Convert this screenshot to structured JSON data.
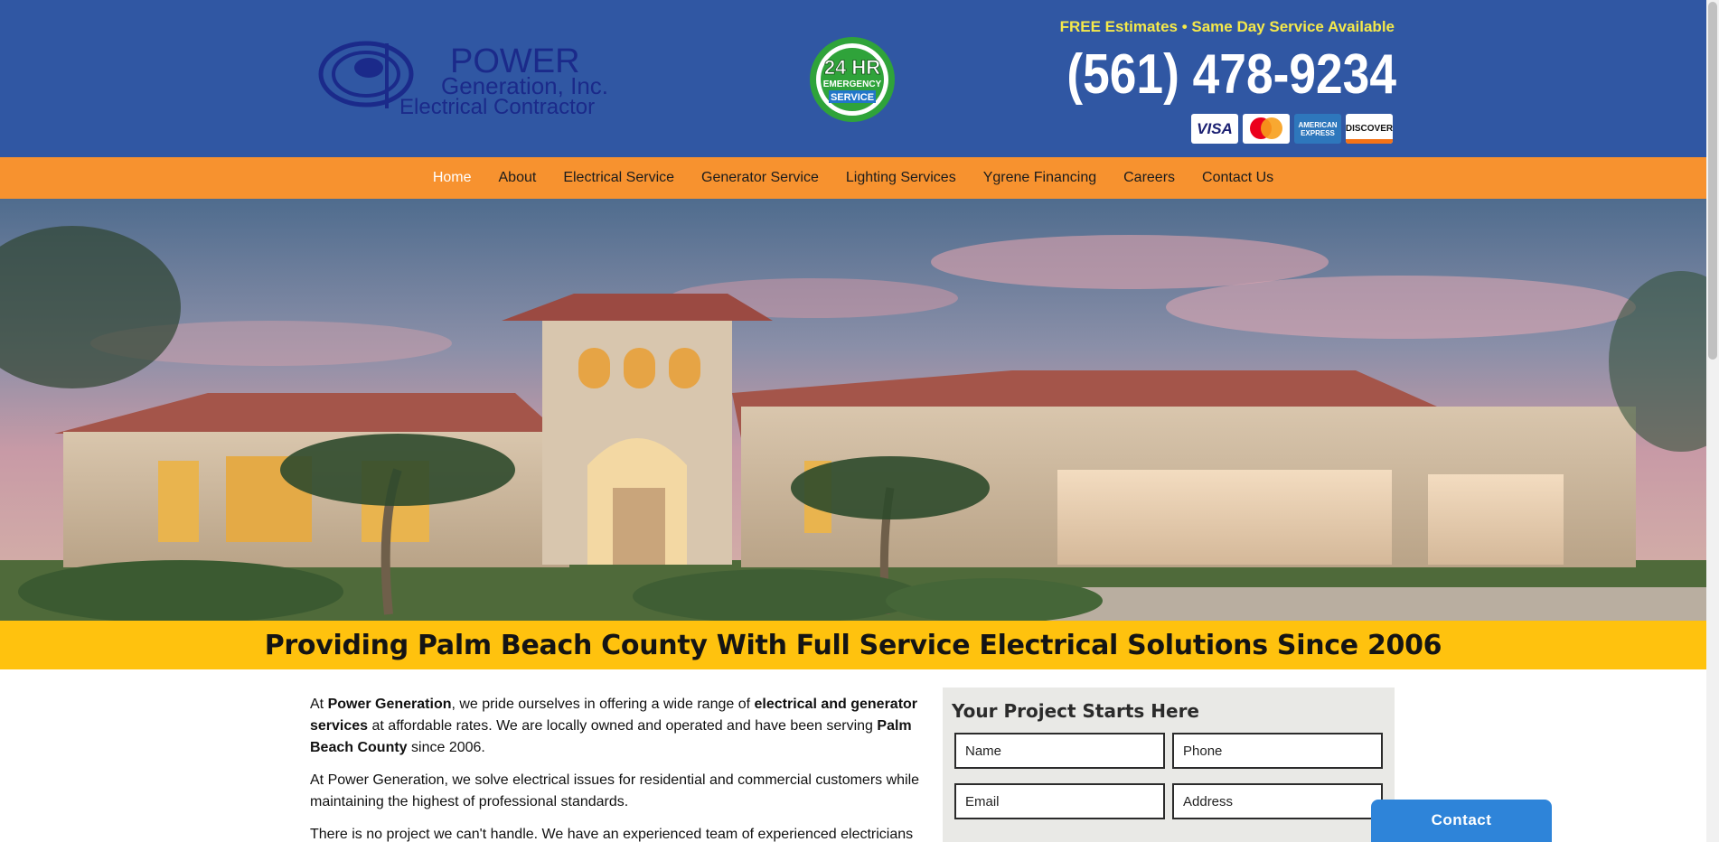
{
  "header": {
    "logo_line1": "POWER",
    "logo_line2": "Generation, Inc.",
    "logo_line3": "Electrical Contractor",
    "badge_line1": "24 HR",
    "badge_line2": "EMERGENCY",
    "badge_line3": "SERVICE",
    "tagline": "FREE Estimates • Same Day Service Available",
    "phone": "(561) 478-9234",
    "cards": {
      "visa": "VISA",
      "amex": "AMERICAN EXPRESS",
      "discover": "DISCOVER"
    }
  },
  "nav": {
    "items": [
      "Home",
      "About",
      "Electrical Service",
      "Generator Service",
      "Lighting Services",
      "Ygrene Financing",
      "Careers",
      "Contact Us"
    ]
  },
  "banner": {
    "heading": "Providing Palm Beach County With Full Service Electrical Solutions Since 2006"
  },
  "content": {
    "p1_a": "At ",
    "p1_b": "Power Generation",
    "p1_c": ", we pride ourselves in offering a wide range of ",
    "p1_d": "electrical and generator services",
    "p1_e": " at affordable rates. We are locally owned and operated and have been serving ",
    "p1_f": "Palm Beach County",
    "p1_g": " since 2006.",
    "p2": "At Power Generation, we solve electrical issues for residential and commercial customers while maintaining the highest of professional standards.",
    "p3": "There is no project we can't handle. We have an experienced team of experienced electricians"
  },
  "form": {
    "title": "Your Project Starts Here",
    "name_placeholder": "Name",
    "phone_placeholder": "Phone",
    "email_placeholder": "Email",
    "address_placeholder": "Address"
  },
  "contact_button": "Contact",
  "colors": {
    "header_bg": "#3057a3",
    "nav_bg": "#f7922f",
    "banner_bg": "#ffc20e",
    "tagline": "#f5e94a",
    "contact_btn": "#2e84d9"
  }
}
